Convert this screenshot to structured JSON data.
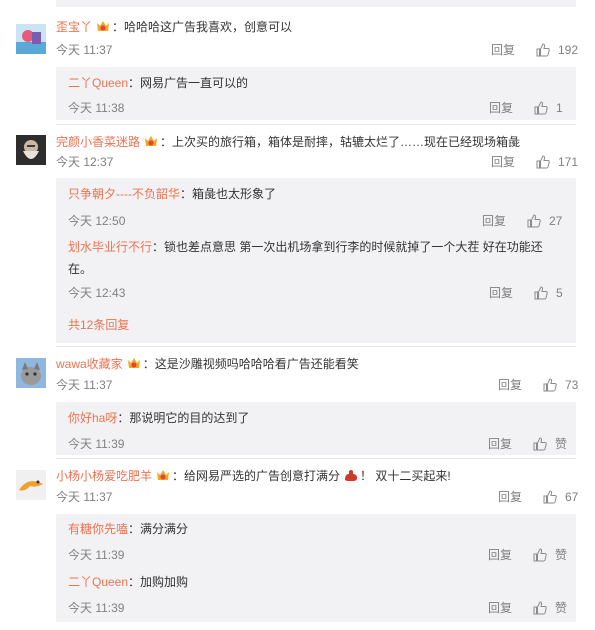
{
  "comments": [
    {
      "username": "歪宝丫",
      "text": "哈哈哈这广告我喜欢，创意可以",
      "time": "今天 11:37",
      "reply_label": "回复",
      "likes": "192",
      "replies": [
        {
          "username": "二丫Queen",
          "text": "网易广告一直可以的",
          "time": "今天 11:38",
          "reply_label": "回复",
          "likes": "1"
        }
      ]
    },
    {
      "username": "完颜小香菜迷路",
      "text": "上次买的旅行箱，箱体是耐摔，轱辘太烂了……现在已经现场箱彘",
      "time": "今天 12:37",
      "reply_label": "回复",
      "likes": "171",
      "replies": [
        {
          "username": "只争朝夕----不负韶华",
          "text": "箱彘也太形象了",
          "time": "今天 12:50",
          "reply_label": "回复",
          "likes": "27"
        },
        {
          "username": "划水毕业行不行",
          "text": "锁也差点意思 第一次出机场拿到行李的时候就掉了一个大茬  好在功能还在。",
          "time": "今天 12:43",
          "reply_label": "回复",
          "likes": "5"
        }
      ],
      "more_replies": "共12条回复"
    },
    {
      "username": "wawa收藏家",
      "text": "这是沙雕视频吗哈哈哈看广告还能看笑",
      "time": "今天 11:37",
      "reply_label": "回复",
      "likes": "73",
      "replies": [
        {
          "username": "你好ha呀",
          "text": "那说明它的目的达到了",
          "time": "今天 11:39",
          "reply_label": "回复",
          "likes": "赞"
        }
      ]
    },
    {
      "username": "小杨小杨爱吃肥羊",
      "text": "给网易严选的广告创意打满分",
      "text_after": "！ 双十二买起来!",
      "time": "今天 11:37",
      "reply_label": "回复",
      "likes": "67",
      "replies": [
        {
          "username": "有糖你先嗑",
          "text": "满分满分",
          "time": "今天 11:39",
          "reply_label": "回复",
          "likes": "赞"
        },
        {
          "username": "二丫Queen",
          "text": "加购加购",
          "time": "今天 11:39",
          "reply_label": "回复",
          "likes": "赞"
        }
      ]
    }
  ],
  "colors": {
    "username": "#eb7350",
    "meta": "#808080",
    "subbox_bg": "#f2f2f5",
    "text": "#333333"
  },
  "icons": {
    "vip_badge": "vip-badge-icon",
    "like": "thumbs-up-icon",
    "emoji": "muscle-emoji-icon"
  }
}
